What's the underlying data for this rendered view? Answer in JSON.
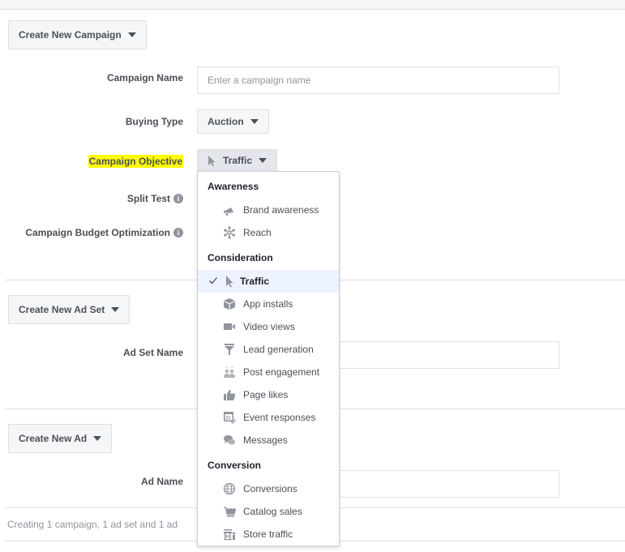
{
  "campaign": {
    "create_button_label": "Create New Campaign",
    "name_label": "Campaign Name",
    "name_placeholder": "Enter a campaign name",
    "name_value": "",
    "buying_type_label": "Buying Type",
    "buying_type_value": "Auction",
    "objective_label": "Campaign Objective",
    "objective_value": "Traffic",
    "split_test_label": "Split Test",
    "budget_optimization_label": "Campaign Budget Optimization"
  },
  "ad_set": {
    "create_button_label": "Create New Ad Set",
    "name_label": "Ad Set Name",
    "name_value": ""
  },
  "ad": {
    "create_button_label": "Create New Ad",
    "name_label": "Ad Name",
    "name_value": ""
  },
  "status_text": "Creating 1 campaign, 1 ad set and 1 ad",
  "objective_menu": {
    "groups": [
      {
        "header": "Awareness",
        "items": [
          {
            "label": "Brand awareness",
            "icon": "megaphone-icon"
          },
          {
            "label": "Reach",
            "icon": "reach-icon"
          }
        ]
      },
      {
        "header": "Consideration",
        "items": [
          {
            "label": "Traffic",
            "icon": "cursor-icon",
            "selected": true
          },
          {
            "label": "App installs",
            "icon": "box-icon"
          },
          {
            "label": "Video views",
            "icon": "video-camera-icon"
          },
          {
            "label": "Lead generation",
            "icon": "funnel-icon"
          },
          {
            "label": "Post engagement",
            "icon": "people-icon"
          },
          {
            "label": "Page likes",
            "icon": "thumbs-up-icon"
          },
          {
            "label": "Event responses",
            "icon": "calendar-icon"
          },
          {
            "label": "Messages",
            "icon": "chat-bubbles-icon"
          }
        ]
      },
      {
        "header": "Conversion",
        "items": [
          {
            "label": "Conversions",
            "icon": "globe-icon"
          },
          {
            "label": "Catalog sales",
            "icon": "cart-icon"
          },
          {
            "label": "Store traffic",
            "icon": "store-icon"
          }
        ]
      }
    ]
  },
  "colors": {
    "highlight": "#ffff00",
    "selected_item_bg": "#ecf3ff",
    "icon_gray": "#90949c"
  }
}
